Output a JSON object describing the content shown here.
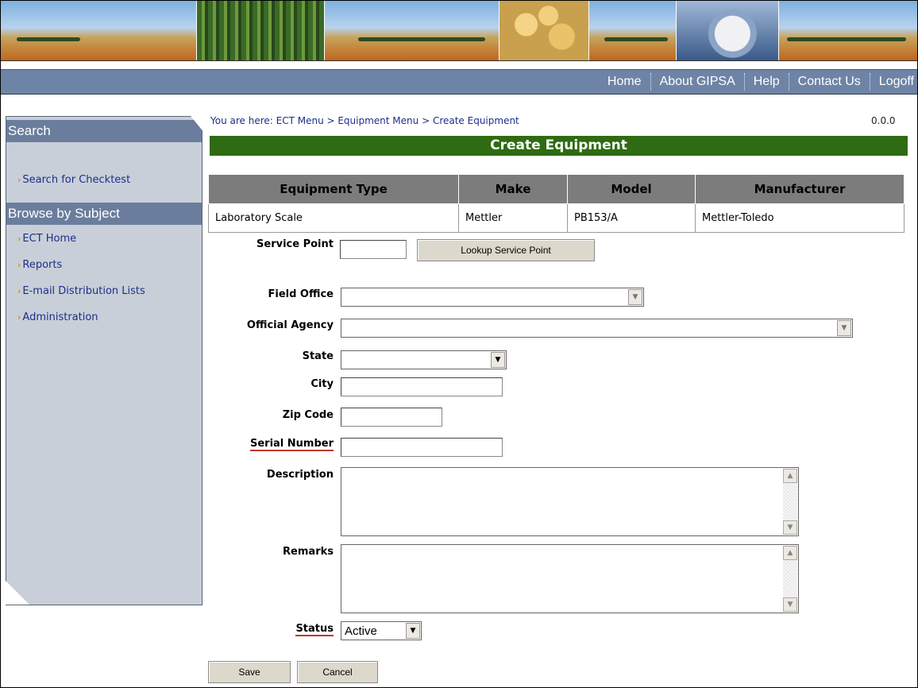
{
  "nav": {
    "links": [
      "Home",
      "About GIPSA",
      "Help",
      "Contact Us",
      "Logoff"
    ]
  },
  "sidebar": {
    "search_heading": "Search",
    "search_link": "Search for Checktest",
    "browse_heading": "Browse by Subject",
    "items": [
      "ECT Home",
      "Reports",
      "E-mail Distribution Lists",
      "Administration"
    ]
  },
  "breadcrumb": "You are here: ECT Menu > Equipment Menu > Create Equipment",
  "version": "0.0.0",
  "page_title": "Create Equipment",
  "equipment_table": {
    "headers": [
      "Equipment Type",
      "Make",
      "Model",
      "Manufacturer"
    ],
    "row": [
      "Laboratory Scale",
      "Mettler",
      "PB153/A",
      "Mettler-Toledo"
    ]
  },
  "form": {
    "service_point_label": "Service Point",
    "service_point_value": "",
    "lookup_button": "Lookup Service Point",
    "field_office_label": "Field Office",
    "field_office_value": "",
    "official_agency_label": "Official Agency",
    "official_agency_value": "",
    "state_label": "State",
    "state_value": "",
    "city_label": "City",
    "city_value": "",
    "zip_label": "Zip Code",
    "zip_value": "",
    "serial_label": "Serial Number",
    "serial_value": "",
    "description_label": "Description",
    "remarks_label": "Remarks",
    "status_label": "Status",
    "status_value": "Active",
    "save_button": "Save",
    "cancel_button": "Cancel"
  },
  "colors": {
    "title_bar": "#2f6b12",
    "nav_bar": "#6e84a6",
    "sidebar_heading": "#6a7d9d",
    "sidebar_bg": "#c9cfd8",
    "link": "#1b2f8a",
    "required_underline": "#c0392b"
  }
}
